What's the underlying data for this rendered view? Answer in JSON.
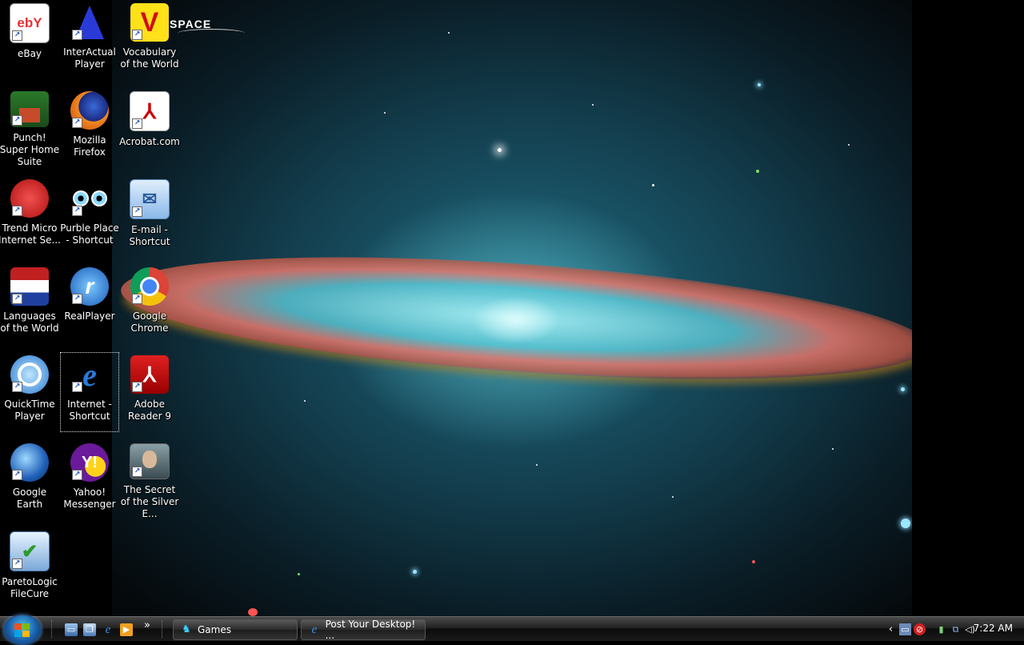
{
  "desktop": {
    "icons": [
      {
        "label": "eBay"
      },
      {
        "label": "InterActual Player"
      },
      {
        "label": "Vocabulary of the World"
      },
      {
        "label": "Punch! Super Home Suite"
      },
      {
        "label": "Mozilla Firefox"
      },
      {
        "label": "Acrobat.com"
      },
      {
        "label": "Trend Micro Internet Se..."
      },
      {
        "label": "Purble Place - Shortcut"
      },
      {
        "label": "E-mail - Shortcut"
      },
      {
        "label": "Languages of the World"
      },
      {
        "label": "RealPlayer"
      },
      {
        "label": "Google Chrome"
      },
      {
        "label": "QuickTime Player"
      },
      {
        "label": "Internet - Shortcut"
      },
      {
        "label": "Adobe Reader 9"
      },
      {
        "label": "Google Earth"
      },
      {
        "label": "Yahoo! Messenger"
      },
      {
        "label": "The Secret of the Silver E..."
      },
      {
        "label": "ParetoLogic FileCure"
      }
    ],
    "logo_text": "SPACE",
    "ebay_logo": "ebY",
    "vocab_logo": "V",
    "selected_icon": "Internet - Shortcut"
  },
  "taskbar": {
    "quick_launch_more": "»",
    "tasks": [
      {
        "label": "Games"
      },
      {
        "label": "Post Your Desktop! ..."
      }
    ],
    "tray_expand": "‹",
    "clock": "7:22 AM"
  },
  "colors": {
    "taskbar": "#1a1a1a",
    "start_orb": "#1a5fa8"
  }
}
